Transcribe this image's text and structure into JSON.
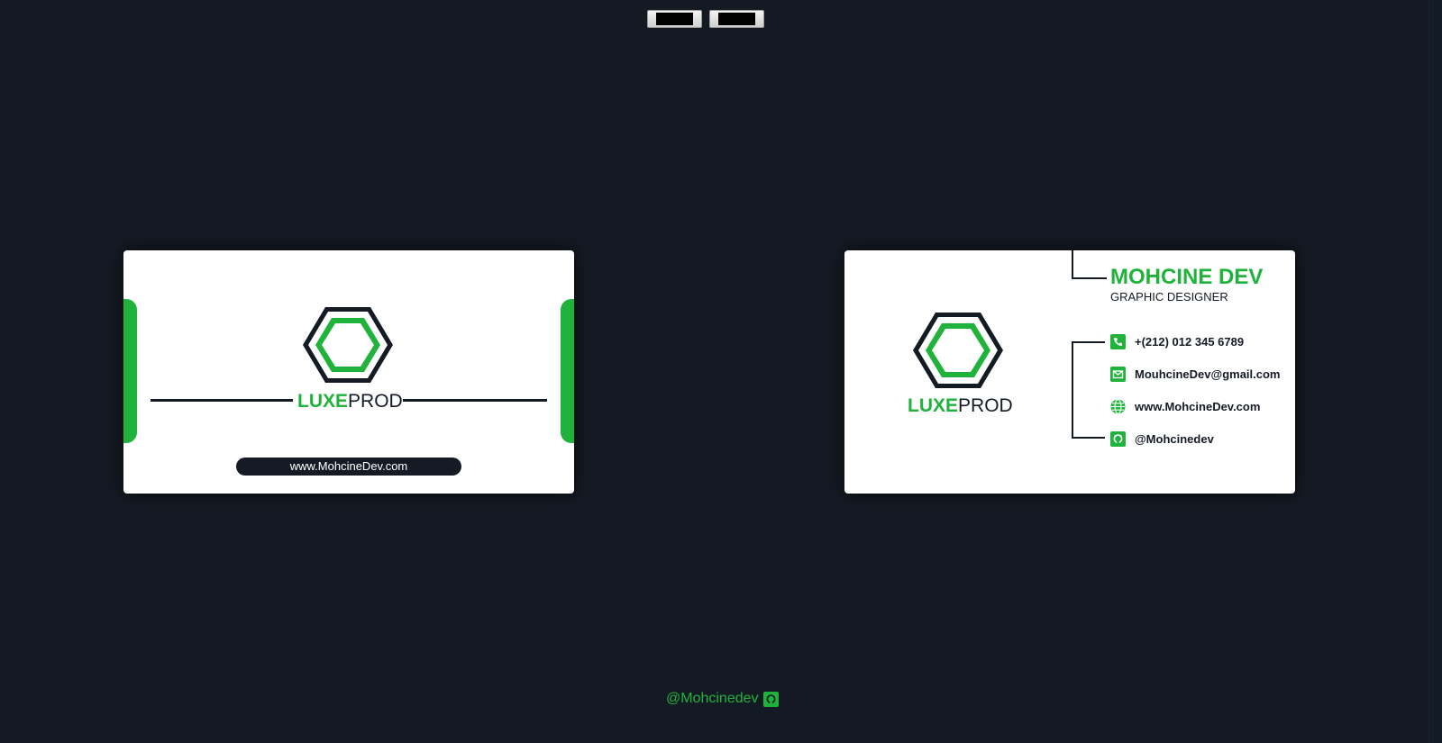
{
  "colors": {
    "background": "#141a23",
    "accent": "#1fb33b",
    "dark": "#151b24",
    "card": "#ffffff"
  },
  "controls": [
    {
      "name": "front-toggle-button",
      "label": ""
    },
    {
      "name": "back-toggle-button",
      "label": ""
    }
  ],
  "front": {
    "brand_luxe": "LUXE",
    "brand_prod": "PROD",
    "url": "www.MohcineDev.com",
    "logo_icon": "hexagon-logo-icon"
  },
  "back": {
    "brand_luxe": "LUXE",
    "brand_prod": "PROD",
    "name": "MOHCINE DEV",
    "title": "GRAPHIC DESIGNER",
    "contacts": [
      {
        "icon": "phone-icon",
        "text": "+(212) 012 345 6789"
      },
      {
        "icon": "mail-icon",
        "text": "MouhcineDev@gmail.com"
      },
      {
        "icon": "globe-icon",
        "text": "www.MohcineDev.com"
      },
      {
        "icon": "github-icon",
        "text": "@Mohcinedev"
      }
    ]
  },
  "footer": {
    "handle": "@Mohcinedev",
    "icon": "github-icon"
  }
}
